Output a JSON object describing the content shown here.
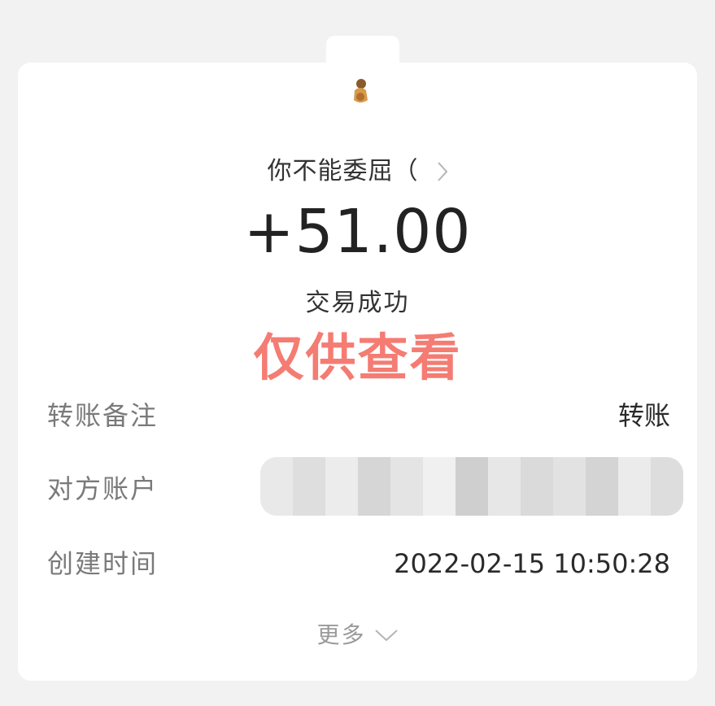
{
  "counterparty": {
    "name": "你不能委屈（"
  },
  "transaction": {
    "amount": "+51.00",
    "status": "交易成功"
  },
  "watermark": "仅供查看",
  "details": {
    "remark": {
      "label": "转账备注",
      "value": "转账"
    },
    "account": {
      "label": "对方账户",
      "value": ""
    },
    "created": {
      "label": "创建时间",
      "value": "2022-02-15 10:50:28"
    }
  },
  "more_label": "更多",
  "icons": {
    "avatar": "avatar-icon",
    "name_chevron": "chevron-right-icon",
    "more_chevron": "chevron-down-icon"
  }
}
